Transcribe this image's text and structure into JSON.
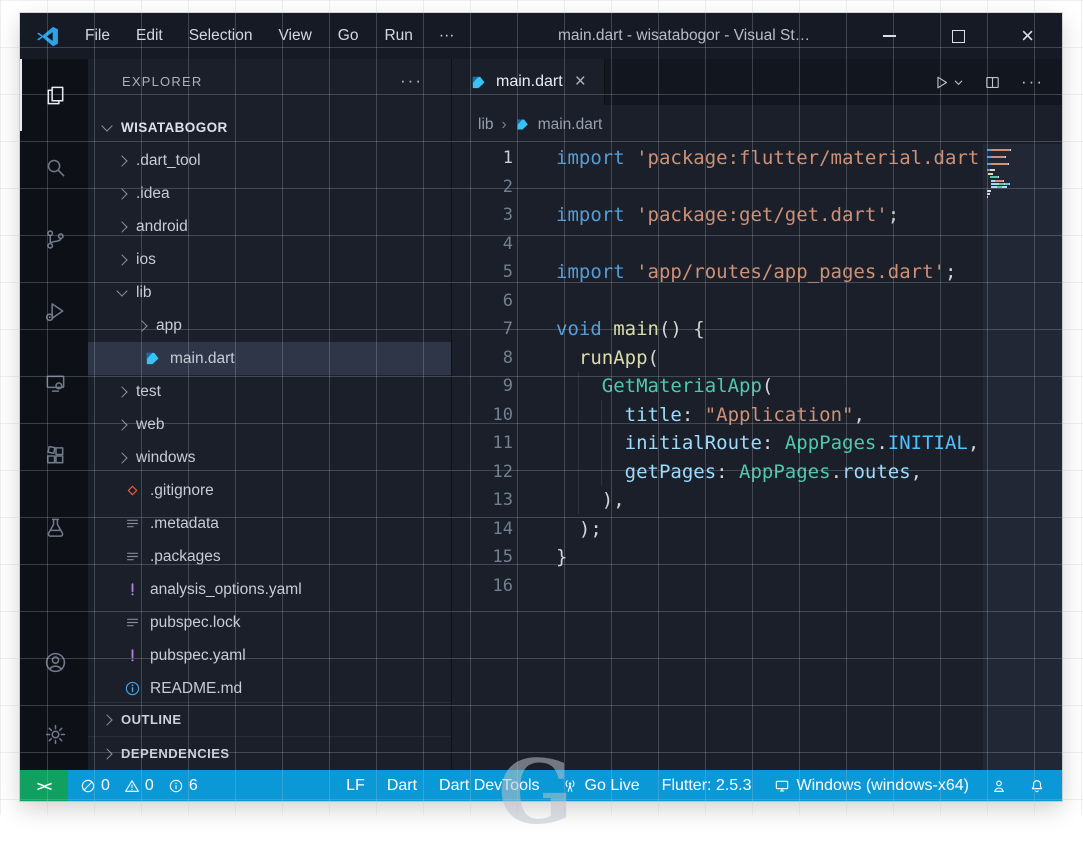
{
  "window": {
    "title": "main.dart - wisatabogor - Visual St…",
    "menus": [
      "File",
      "Edit",
      "Selection",
      "View",
      "Go",
      "Run",
      "···"
    ],
    "controls": {
      "minimize": "—",
      "maximize": "□",
      "close": "×"
    }
  },
  "activity_bar": {
    "top": [
      {
        "name": "explorer",
        "active": true
      },
      {
        "name": "search",
        "active": false
      },
      {
        "name": "source-control",
        "active": false
      },
      {
        "name": "run-debug",
        "active": false
      },
      {
        "name": "remote-explorer",
        "active": false
      },
      {
        "name": "extensions",
        "active": false
      },
      {
        "name": "testing",
        "active": false
      }
    ],
    "bottom": [
      {
        "name": "account",
        "active": false
      },
      {
        "name": "settings",
        "active": false
      }
    ]
  },
  "sidebar": {
    "header": "EXPLORER",
    "more": "···",
    "root": "WISATABOGOR",
    "items": [
      {
        "label": ".dart_tool",
        "kind": "folder",
        "level": 1
      },
      {
        "label": ".idea",
        "kind": "folder",
        "level": 1
      },
      {
        "label": "android",
        "kind": "folder",
        "level": 1
      },
      {
        "label": "ios",
        "kind": "folder",
        "level": 1
      },
      {
        "label": "lib",
        "kind": "folder",
        "level": 1,
        "expanded": true
      },
      {
        "label": "app",
        "kind": "folder",
        "level": 2
      },
      {
        "label": "main.dart",
        "kind": "dart",
        "level": 2,
        "selected": true
      },
      {
        "label": "test",
        "kind": "folder",
        "level": 1
      },
      {
        "label": "web",
        "kind": "folder",
        "level": 1
      },
      {
        "label": "windows",
        "kind": "folder",
        "level": 1
      },
      {
        "label": ".gitignore",
        "kind": "git",
        "level": 1
      },
      {
        "label": ".metadata",
        "kind": "text",
        "level": 1
      },
      {
        "label": ".packages",
        "kind": "text",
        "level": 1
      },
      {
        "label": "analysis_options.yaml",
        "kind": "yaml",
        "level": 1
      },
      {
        "label": "pubspec.lock",
        "kind": "text",
        "level": 1
      },
      {
        "label": "pubspec.yaml",
        "kind": "yaml",
        "level": 1
      },
      {
        "label": "README.md",
        "kind": "info",
        "level": 1
      }
    ],
    "sections": [
      "OUTLINE",
      "DEPENDENCIES"
    ]
  },
  "editor": {
    "tab": {
      "label": "main.dart",
      "close": "×"
    },
    "breadcrumbs": [
      "lib",
      "main.dart"
    ],
    "breadcrumb_sep": "›",
    "actions_more": "···",
    "active_line": 1,
    "lines": [
      {
        "n": "1",
        "tokens": [
          [
            "kw",
            "import"
          ],
          [
            "pl",
            " "
          ],
          [
            "str",
            "'package:flutter/material.dart'"
          ],
          [
            "pl",
            ";"
          ]
        ]
      },
      {
        "n": "2",
        "tokens": []
      },
      {
        "n": "3",
        "tokens": [
          [
            "kw",
            "import"
          ],
          [
            "pl",
            " "
          ],
          [
            "str",
            "'package:get/get.dart'"
          ],
          [
            "pl",
            ";"
          ]
        ]
      },
      {
        "n": "4",
        "tokens": []
      },
      {
        "n": "5",
        "tokens": [
          [
            "kw",
            "import"
          ],
          [
            "pl",
            " "
          ],
          [
            "str",
            "'app/routes/app_pages.dart'"
          ],
          [
            "pl",
            ";"
          ]
        ]
      },
      {
        "n": "6",
        "tokens": []
      },
      {
        "n": "7",
        "tokens": [
          [
            "kw",
            "void"
          ],
          [
            "pl",
            " "
          ],
          [
            "fn",
            "main"
          ],
          [
            "pl",
            "() {"
          ]
        ]
      },
      {
        "n": "8",
        "tokens": [
          [
            "pl",
            "  "
          ],
          [
            "fn",
            "runApp"
          ],
          [
            "pl",
            "("
          ]
        ]
      },
      {
        "n": "9",
        "tokens": [
          [
            "pl",
            "    "
          ],
          [
            "cls",
            "GetMaterialApp"
          ],
          [
            "pl",
            "("
          ]
        ]
      },
      {
        "n": "10",
        "tokens": [
          [
            "pl",
            "      "
          ],
          [
            "prop",
            "title"
          ],
          [
            "pl",
            ": "
          ],
          [
            "str",
            "\"Application\""
          ],
          [
            "pl",
            ","
          ]
        ]
      },
      {
        "n": "11",
        "tokens": [
          [
            "pl",
            "      "
          ],
          [
            "prop",
            "initialRoute"
          ],
          [
            "pl",
            ": "
          ],
          [
            "cls",
            "AppPages"
          ],
          [
            "pl",
            "."
          ],
          [
            "cst",
            "INITIAL"
          ],
          [
            "pl",
            ","
          ]
        ]
      },
      {
        "n": "12",
        "tokens": [
          [
            "pl",
            "      "
          ],
          [
            "prop",
            "getPages"
          ],
          [
            "pl",
            ": "
          ],
          [
            "cls",
            "AppPages"
          ],
          [
            "pl",
            "."
          ],
          [
            "prop",
            "routes"
          ],
          [
            "pl",
            ","
          ]
        ]
      },
      {
        "n": "13",
        "tokens": [
          [
            "pl",
            "    ),"
          ]
        ]
      },
      {
        "n": "14",
        "tokens": [
          [
            "pl",
            "  );"
          ]
        ]
      },
      {
        "n": "15",
        "tokens": [
          [
            "pl",
            "}"
          ]
        ]
      },
      {
        "n": "16",
        "tokens": []
      }
    ]
  },
  "status_bar": {
    "remote": "><",
    "problems": {
      "errors": "0",
      "warnings": "0",
      "info": "6"
    },
    "right": [
      {
        "label": "LF"
      },
      {
        "label": "Dart"
      },
      {
        "label": "Dart DevTools"
      },
      {
        "icon": "broadcast",
        "label": "Go Live"
      },
      {
        "label": "Flutter: 2.5.3"
      },
      {
        "icon": "monitor",
        "label": "Windows (windows-x64)"
      },
      {
        "icon": "feedback",
        "label": ""
      },
      {
        "icon": "bell",
        "label": ""
      }
    ]
  },
  "colors": {
    "status_bar": "#0a99d6",
    "remote_bg": "#10a060",
    "accent_blue": "#2ba3e8"
  },
  "syntax_colors": {
    "kw": "#569cd6",
    "str": "#ce9178",
    "fn": "#dcdcaa",
    "cls": "#4ec9b0",
    "prop": "#9cdcfe",
    "cst": "#4fc1ff",
    "pl": "#d4d4d4"
  },
  "watermark": "G"
}
